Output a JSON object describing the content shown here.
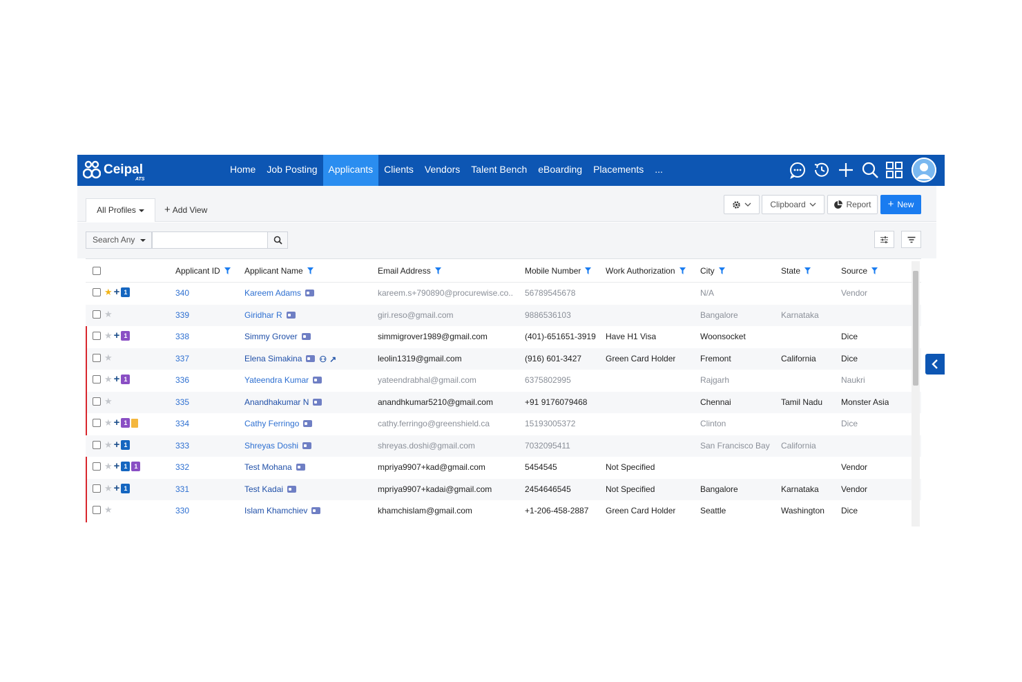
{
  "brand": {
    "name": "Ceipal",
    "sub": "ATS"
  },
  "nav": [
    "Home",
    "Job Posting",
    "Applicants",
    "Clients",
    "Vendors",
    "Talent Bench",
    "eBoarding",
    "Placements",
    "..."
  ],
  "nav_active": "Applicants",
  "top_icons": [
    "chat-icon",
    "history-icon",
    "plus-icon",
    "search-icon",
    "grid-icon"
  ],
  "toolbar": {
    "profiles_label": "All Profiles",
    "add_view_label": "Add View",
    "clipboard_label": "Clipboard",
    "report_label": "Report",
    "new_label": "New"
  },
  "search": {
    "dropdown_label": "Search Any",
    "value": ""
  },
  "columns": [
    "Applicant ID",
    "Applicant Name",
    "Email Address",
    "Mobile Number",
    "Work Authorization",
    "City",
    "State",
    "Source"
  ],
  "rows": [
    {
      "id": "340",
      "name": "Kareem Adams",
      "email": "kareem.s+790890@procurewise.co..",
      "mobile": "56789545678",
      "work_auth": "",
      "city": "N/A",
      "state": "",
      "source": "Vendor",
      "star": true,
      "plus": true,
      "badges": [
        {
          "t": "1",
          "c": "blue"
        }
      ],
      "doc": false,
      "flag": false,
      "bold": false,
      "extra": false
    },
    {
      "id": "339",
      "name": "Giridhar R",
      "email": "giri.reso@gmail.com",
      "mobile": "9886536103",
      "work_auth": "",
      "city": "Bangalore",
      "state": "Karnataka",
      "source": "",
      "star": false,
      "plus": false,
      "badges": [],
      "doc": false,
      "flag": false,
      "bold": false,
      "extra": false
    },
    {
      "id": "338",
      "name": "Simmy Grover",
      "email": "simmigrover1989@gmail.com",
      "mobile": "(401)-651651-3919",
      "work_auth": "Have H1 Visa",
      "city": "Woonsocket",
      "state": "",
      "source": "Dice",
      "star": false,
      "plus": true,
      "badges": [
        {
          "t": "1",
          "c": "purple"
        }
      ],
      "doc": false,
      "flag": true,
      "bold": true,
      "extra": false
    },
    {
      "id": "337",
      "name": "Elena Simakina",
      "email": "leolin1319@gmail.com",
      "mobile": "(916) 601-3427",
      "work_auth": "Green Card Holder",
      "city": "Fremont",
      "state": "California",
      "source": "Dice",
      "star": false,
      "plus": false,
      "badges": [],
      "doc": false,
      "flag": true,
      "bold": true,
      "extra": true
    },
    {
      "id": "336",
      "name": "Yateendra Kumar",
      "email": "yateendrabhal@gmail.com",
      "mobile": "6375802995",
      "work_auth": "",
      "city": "Rajgarh",
      "state": "",
      "source": "Naukri",
      "star": false,
      "plus": true,
      "badges": [
        {
          "t": "1",
          "c": "purple"
        }
      ],
      "doc": false,
      "flag": true,
      "bold": false,
      "extra": false
    },
    {
      "id": "335",
      "name": "Anandhakumar N",
      "email": "anandhkumar5210@gmail.com",
      "mobile": "+91 9176079468",
      "work_auth": "",
      "city": "Chennai",
      "state": "Tamil Nadu",
      "source": "Monster Asia",
      "star": false,
      "plus": false,
      "badges": [],
      "doc": false,
      "flag": true,
      "bold": true,
      "extra": false
    },
    {
      "id": "334",
      "name": "Cathy Ferringo",
      "email": "cathy.ferringo@greenshield.ca",
      "mobile": "15193005372",
      "work_auth": "",
      "city": "Clinton",
      "state": "",
      "source": "Dice",
      "star": false,
      "plus": true,
      "badges": [
        {
          "t": "1",
          "c": "purple"
        }
      ],
      "doc": true,
      "flag": true,
      "bold": false,
      "extra": false
    },
    {
      "id": "333",
      "name": "Shreyas Doshi",
      "email": "shreyas.doshi@gmail.com",
      "mobile": "7032095411",
      "work_auth": "",
      "city": "San Francisco Bay",
      "state": "California",
      "source": "",
      "star": false,
      "plus": true,
      "badges": [
        {
          "t": "1",
          "c": "blue"
        }
      ],
      "doc": false,
      "flag": false,
      "bold": false,
      "extra": false
    },
    {
      "id": "332",
      "name": "Test Mohana",
      "email": "mpriya9907+kad@gmail.com",
      "mobile": "5454545",
      "work_auth": "Not Specified",
      "city": "",
      "state": "",
      "source": "Vendor",
      "star": false,
      "plus": true,
      "badges": [
        {
          "t": "1",
          "c": "blue"
        },
        {
          "t": "1",
          "c": "purple"
        }
      ],
      "doc": false,
      "flag": true,
      "bold": true,
      "extra": false
    },
    {
      "id": "331",
      "name": "Test Kadai",
      "email": "mpriya9907+kadai@gmail.com",
      "mobile": "2454646545",
      "work_auth": "Not Specified",
      "city": "Bangalore",
      "state": "Karnataka",
      "source": "Vendor",
      "star": false,
      "plus": true,
      "badges": [
        {
          "t": "1",
          "c": "blue"
        }
      ],
      "doc": false,
      "flag": true,
      "bold": true,
      "extra": false
    },
    {
      "id": "330",
      "name": "Islam Khamchiev",
      "email": "khamchislam@gmail.com",
      "mobile": "+1-206-458-2887",
      "work_auth": "Green Card Holder",
      "city": "Seattle",
      "state": "Washington",
      "source": "Dice",
      "star": false,
      "plus": false,
      "badges": [],
      "doc": false,
      "flag": true,
      "bold": true,
      "extra": false
    }
  ],
  "colors": {
    "nav_bg": "#0d56b3",
    "nav_active": "#2a8df0",
    "primary_button": "#1a7cf0",
    "row_flag": "#d8262c",
    "link": "#2d6fd1"
  }
}
